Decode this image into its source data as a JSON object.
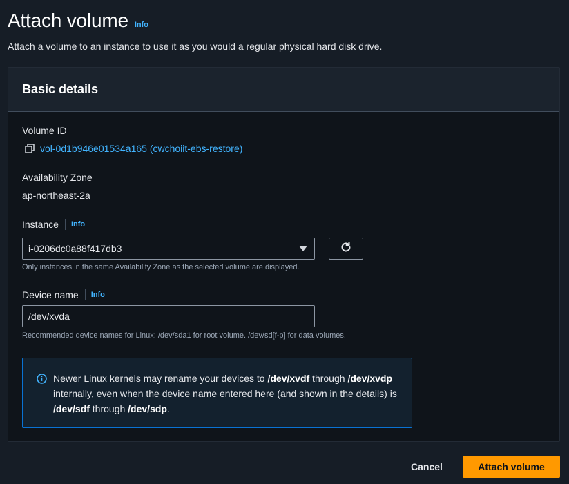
{
  "header": {
    "title": "Attach volume",
    "info_label": "Info",
    "description": "Attach a volume to an instance to use it as you would a regular physical hard disk drive."
  },
  "panel": {
    "title": "Basic details"
  },
  "volume": {
    "label": "Volume ID",
    "value": "vol-0d1b946e01534a165 (cwchoiit-ebs-restore)"
  },
  "availability_zone": {
    "label": "Availability Zone",
    "value": "ap-northeast-2a"
  },
  "instance": {
    "label": "Instance",
    "info_label": "Info",
    "selected": "i-0206dc0a88f417db3",
    "hint": "Only instances in the same Availability Zone as the selected volume are displayed."
  },
  "device": {
    "label": "Device name",
    "info_label": "Info",
    "value": "/dev/xvda",
    "hint": "Recommended device names for Linux: /dev/sda1 for root volume. /dev/sd[f-p] for data volumes."
  },
  "alert": {
    "text_1": "Newer Linux kernels may rename your devices to ",
    "bold_1": "/dev/xvdf",
    "text_2": " through ",
    "bold_2": "/dev/xvdp",
    "text_3": " internally, even when the device name entered here (and shown in the details) is ",
    "bold_3": "/dev/sdf",
    "text_4": " through ",
    "bold_4": "/dev/sdp",
    "text_5": "."
  },
  "footer": {
    "cancel_label": "Cancel",
    "attach_label": "Attach volume"
  },
  "colors": {
    "background": "#161d26",
    "link": "#42b4ff",
    "primary_button": "#ff9900",
    "alert_border": "#0972d3"
  },
  "icons": [
    "copy-icon",
    "caret-down-icon",
    "refresh-icon",
    "info-circle-icon"
  ]
}
